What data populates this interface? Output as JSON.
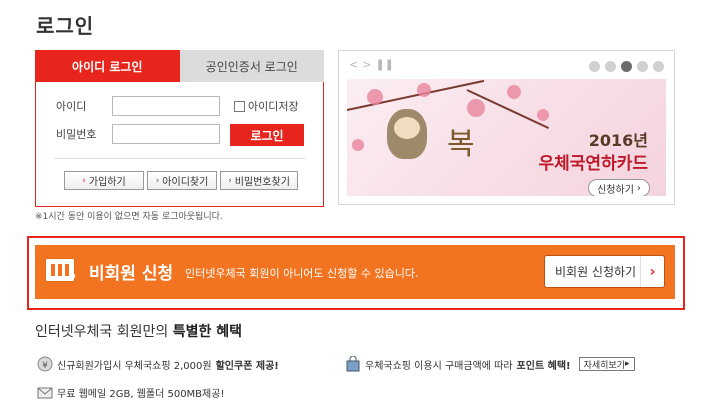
{
  "page": {
    "title": "로그인"
  },
  "login": {
    "tabs": [
      "아이디 로그인",
      "공인인증서 로그인"
    ],
    "id_label": "아이디",
    "pw_label": "비밀번호",
    "id_value": "",
    "pw_value": "",
    "save_id_label": "아이디저장",
    "submit_label": "로그인",
    "buttons": [
      "가입하기",
      "아이디찾기",
      "비밀번호찾기"
    ],
    "notice": "※1시간 동안 이용이 없으면 자동 로그아웃됩니다."
  },
  "banner": {
    "slides_count": 5,
    "active_slide": 3,
    "calligraphy": "복",
    "year": "2016년",
    "title": "우체국연하카드",
    "button_label": "신청하기"
  },
  "non_member": {
    "title": "비회원 신청",
    "description": "인터넷우체국 회원이 아니어도 신청할 수 있습니다.",
    "button_label": "비회원 신청하기"
  },
  "benefits": {
    "title_prefix": "인터넷우체국 회원만의",
    "title_bold": "특별한 혜택",
    "items": [
      {
        "text": "신규회원가입시 우체국쇼핑 2,000원",
        "bold": "할인쿠폰 제공!",
        "icon": "coupon-icon"
      },
      {
        "text": "우체국쇼핑 이용시 구매금액에 따라",
        "bold": "포인트 혜택!",
        "icon": "shopping-bag-icon",
        "more": "자세히보기"
      },
      {
        "text": "무료 웹메일 2GB, 웹폴더 500MB제공!",
        "bold": "",
        "icon": "mail-icon"
      }
    ]
  },
  "colors": {
    "accent": "#e8251c",
    "orange": "#f27420"
  }
}
